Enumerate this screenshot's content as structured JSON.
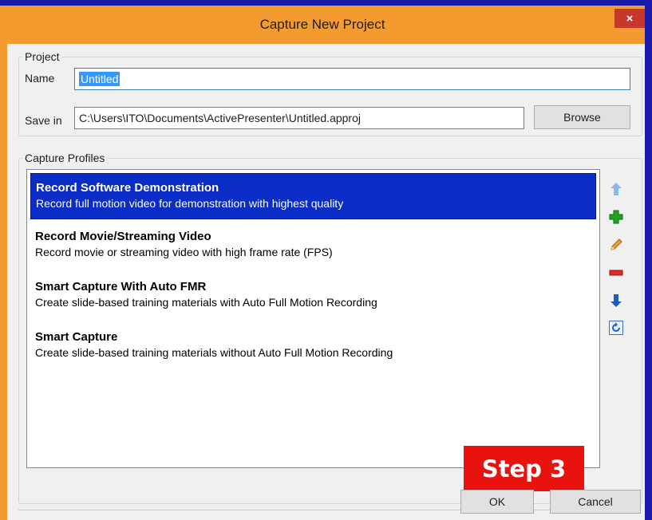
{
  "window": {
    "title": "Capture New Project",
    "close_glyph": "×"
  },
  "project": {
    "legend": "Project",
    "name_label": "Name",
    "name_value": "Untitled",
    "save_label": "Save in",
    "save_value": "C:\\Users\\ITO\\Documents\\ActivePresenter\\Untitled.approj",
    "browse_label": "Browse"
  },
  "profiles": {
    "legend": "Capture Profiles",
    "items": [
      {
        "title": "Record Software Demonstration",
        "desc": "Record full motion video for demonstration with highest quality",
        "selected": true
      },
      {
        "title": "Record Movie/Streaming Video",
        "desc": "Record movie or streaming video with high frame rate (FPS)",
        "selected": false
      },
      {
        "title": "Smart Capture With Auto FMR",
        "desc": "Create slide-based training materials with Auto Full Motion Recording",
        "selected": false
      },
      {
        "title": "Smart Capture",
        "desc": "Create slide-based training materials without Auto Full Motion Recording",
        "selected": false
      }
    ],
    "side_buttons": [
      "move-up-icon",
      "add-icon",
      "edit-icon",
      "remove-icon",
      "move-down-icon",
      "reset-icon"
    ]
  },
  "annotation": {
    "badge": "Step 3",
    "badge_color": "#e8130f"
  },
  "buttons": {
    "ok": "OK",
    "cancel": "Cancel"
  },
  "colors": {
    "frame": "#f49b30",
    "selection": "#0a2dc7",
    "close": "#c7382b"
  }
}
